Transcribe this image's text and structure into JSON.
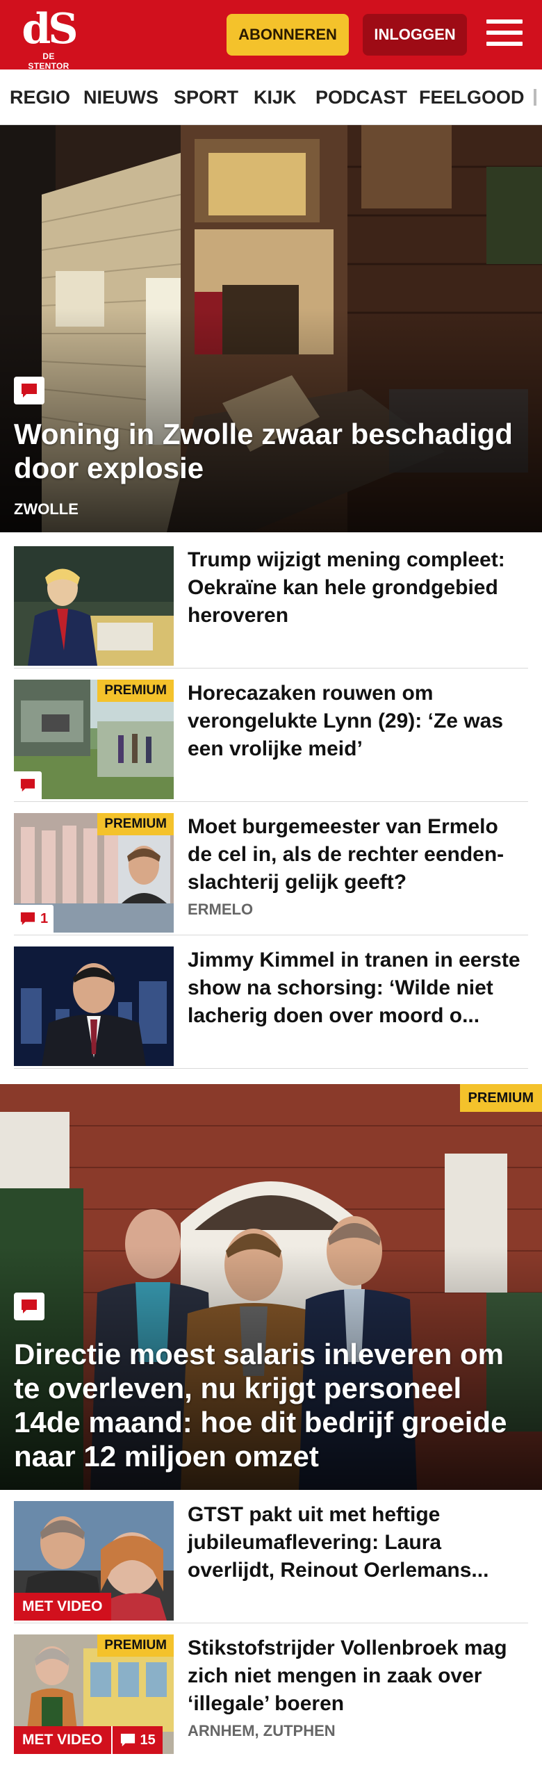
{
  "header": {
    "logo_text": "dS",
    "logo_sub": "DE STENTOR",
    "subscribe_label": "ABONNEREN",
    "login_label": "INLOGGEN",
    "brand_color": "#d1101d",
    "accent_color": "#f4c22b"
  },
  "nav": {
    "items": [
      {
        "label": "REGIO"
      },
      {
        "label": "NIEUWS"
      },
      {
        "label": "SPORT"
      },
      {
        "label": "KIJK"
      },
      {
        "label": "PODCAST"
      },
      {
        "label": "FEELGOOD"
      }
    ]
  },
  "hero1": {
    "title": "Woning in Zwolle zwaar beschadigd door explosie",
    "location": "ZWOLLE",
    "icon": "comment-icon"
  },
  "list1": [
    {
      "title": "Trump wijzigt mening compleet: Oekraïne kan hele grondgebied heroveren",
      "premium": "",
      "location": ""
    },
    {
      "title": "Horecazaken rouwen om verongelukte Lynn (29): ‘Ze was een vrolijke meid’",
      "premium": "PREMIUM",
      "location": ""
    },
    {
      "title": "Moet burgemeester van Ermelo de cel in, als de rechter eenden-slachterij gelijk geeft?",
      "premium": "PREMIUM",
      "location": "ERMELO",
      "comments": "1"
    },
    {
      "title": "Jimmy Kimmel in tranen in eerste show na schorsing: ‘Wilde niet lacherig doen over moord o...",
      "premium": "",
      "location": ""
    }
  ],
  "hero2": {
    "title": "Directie moest salaris inleveren om te overleven, nu krijgt personeel 14de maand: hoe dit bedrijf groeide naar 12 miljoen omzet",
    "premium": "PREMIUM",
    "icon": "comment-icon"
  },
  "list2": [
    {
      "title": "GTST pakt uit met heftige jubileumaflevering: Laura overlijdt, Reinout Oerlemans...",
      "video": "MET VIDEO",
      "premium": "",
      "location": ""
    },
    {
      "title": "Stikstofstrijder Vollenbroek mag zich niet mengen in zaak over ‘illegale’ boeren",
      "video": "MET VIDEO",
      "premium": "PREMIUM",
      "location": "ARNHEM, ZUTPHEN",
      "comments": "15"
    }
  ]
}
